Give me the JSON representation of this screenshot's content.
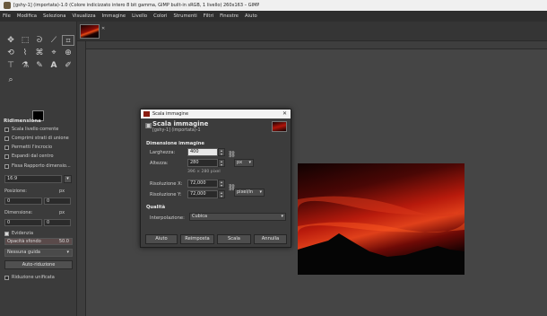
{
  "window": {
    "title": "[gshy-1] (importata)-1.0 (Colore indicizzato intero 8 bit gamma, GIMP built-in sRGB, 1 livello) 260x163 – GIMP"
  },
  "menubar": [
    "File",
    "Modifica",
    "Seleziona",
    "Visualizza",
    "Immagine",
    "Livello",
    "Colori",
    "Strumenti",
    "Filtri",
    "Finestre",
    "Aiuto"
  ],
  "toolbox": {
    "tools_row1": [
      "move-icon",
      "rect-select-icon",
      "lasso-icon",
      "fuzzy-select-icon",
      "crop-icon"
    ],
    "tools_row2": [
      "rotate-icon",
      "warp-icon",
      "cage-icon",
      "perspective-icon",
      "clone-icon"
    ],
    "tools_row3": [
      "text-tool-icon",
      "paint-icon",
      "brush-icon",
      "text-icon",
      "eraser-icon"
    ],
    "tools_row4": [
      "zoom-icon"
    ]
  },
  "tool_options": {
    "title": "Ridimensiona",
    "checks": [
      {
        "label": "Scala livello corrente",
        "checked": false
      },
      {
        "label": "Comprimi strati di unione",
        "checked": false
      },
      {
        "label": "Permetti l'incrocio",
        "checked": false
      },
      {
        "label": "Espandi dal centro",
        "checked": false
      }
    ],
    "fixed_ratio_label": "Fissa Rapporto dimensio...",
    "ratio_value": "16:9",
    "position_label": "Posizione:",
    "position_unit": "px",
    "position_values": [
      "0",
      "0"
    ],
    "size_label": "Dimensione:",
    "size_unit": "px",
    "size_values": [
      "0",
      "0"
    ],
    "highlight_label": "Evidenzia",
    "highlight_opacity_label": "Opacità sfondo",
    "highlight_opacity_value": "50.0",
    "guides_label": "Nessuna guida",
    "autoshrink_label": "Auto-riduzione",
    "shrink_merged_label": "Riduzione unificata"
  },
  "dialog": {
    "window_title": "Scala immagine",
    "title": "Scala immagine",
    "subtitle": "[gshy-1] (importata)-1",
    "section_size": "Dimensione immagine",
    "width_label": "Larghezza:",
    "width_value": "400",
    "height_label": "Altezza:",
    "height_value": "280",
    "size_unit": "px",
    "size_info": "396 × 280 pixel",
    "res_x_label": "Risoluzione X:",
    "res_x_value": "72,000",
    "res_y_label": "Risoluzione Y:",
    "res_y_value": "72,000",
    "res_unit": "pixel/in",
    "section_quality": "Qualità",
    "interp_label": "Interpolazione:",
    "interp_value": "Cubica",
    "buttons": {
      "help": "Aiuto",
      "reset": "Reimposta",
      "scale": "Scala",
      "cancel": "Annulla"
    }
  },
  "colors": {
    "canvas_bg": "#454545",
    "panel_bg": "#3b3b3b",
    "sky_top": "#1a0303",
    "sky_mid": "#c42410",
    "mountain": "#050505"
  }
}
